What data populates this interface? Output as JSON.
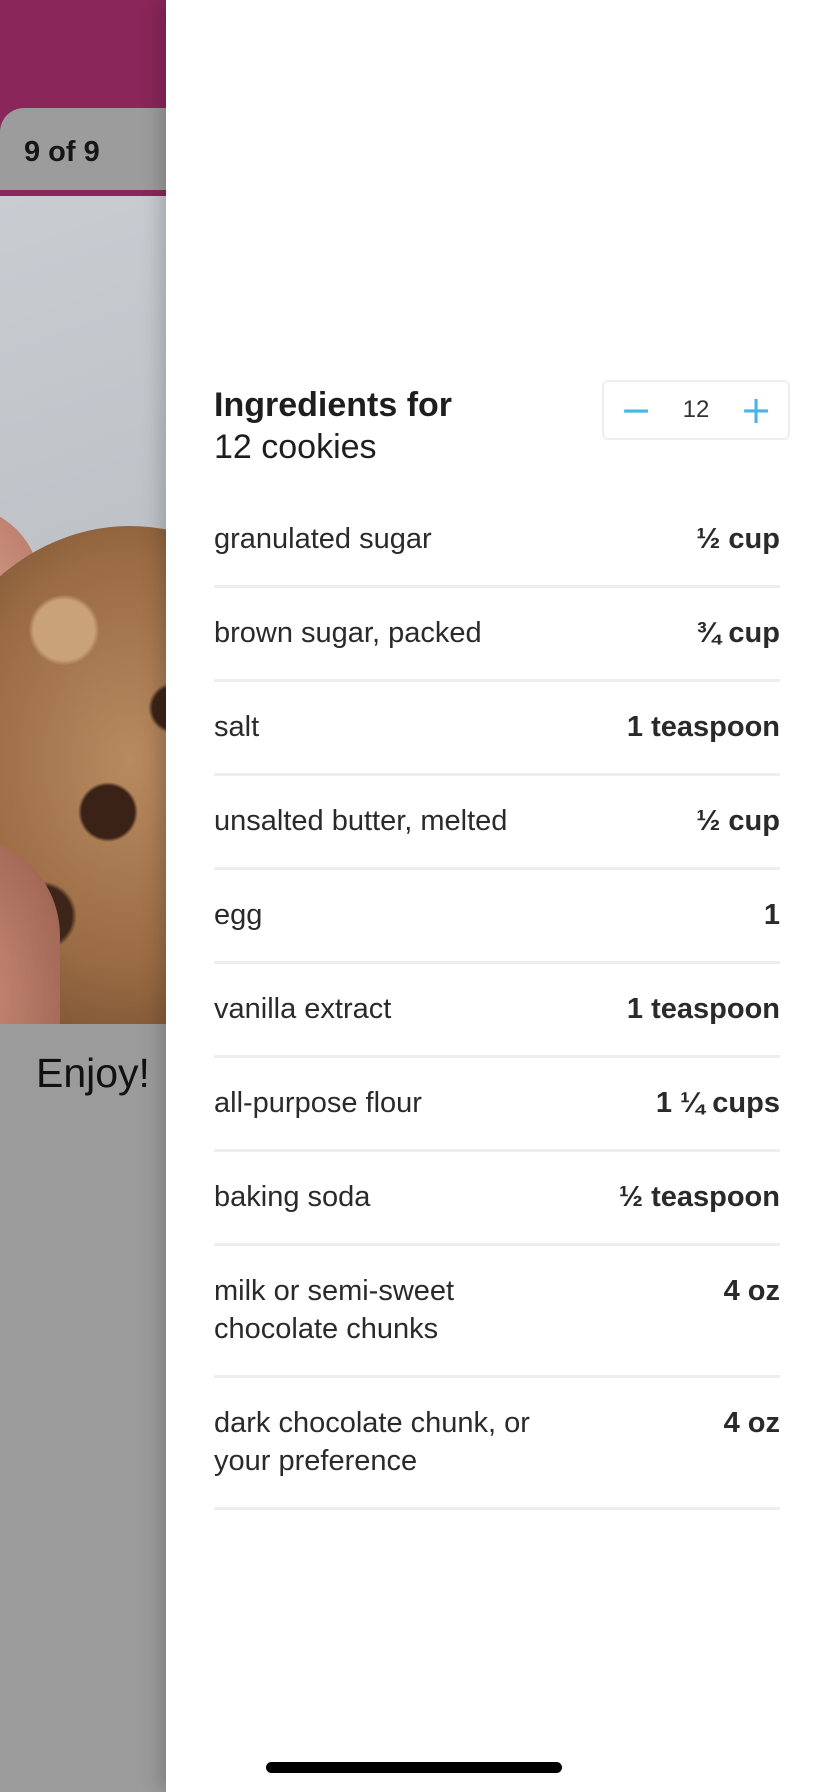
{
  "step_view": {
    "counter": "9 of 9",
    "text": "Enjoy!"
  },
  "ingredients": {
    "heading": "Ingredients for",
    "subheading": "12 cookies",
    "servings_stepper": {
      "decrement_symbol": "−",
      "value": "12",
      "increment_symbol": "+"
    },
    "items": [
      {
        "name": "granulated sugar",
        "quantity": "½ cup"
      },
      {
        "name": "brown sugar, packed",
        "quantity": "¾ cup"
      },
      {
        "name": "salt",
        "quantity": "1 teaspoon"
      },
      {
        "name": "unsalted butter, melted",
        "quantity": "½ cup"
      },
      {
        "name": "egg",
        "quantity": "1"
      },
      {
        "name": "vanilla extract",
        "quantity": "1 teaspoon"
      },
      {
        "name": "all-purpose flour",
        "quantity": "1 ¼ cups"
      },
      {
        "name": "baking soda",
        "quantity": "½ teaspoon"
      },
      {
        "name": "milk or semi-sweet chocolate chunks",
        "quantity": "4 oz"
      },
      {
        "name": "dark chocolate chunk, or your preference",
        "quantity": "4 oz"
      }
    ]
  },
  "colors": {
    "header_brand": "#8a2659",
    "stepper_accent": "#4ab4e6",
    "overlay_gray": "#9b9b9b"
  }
}
